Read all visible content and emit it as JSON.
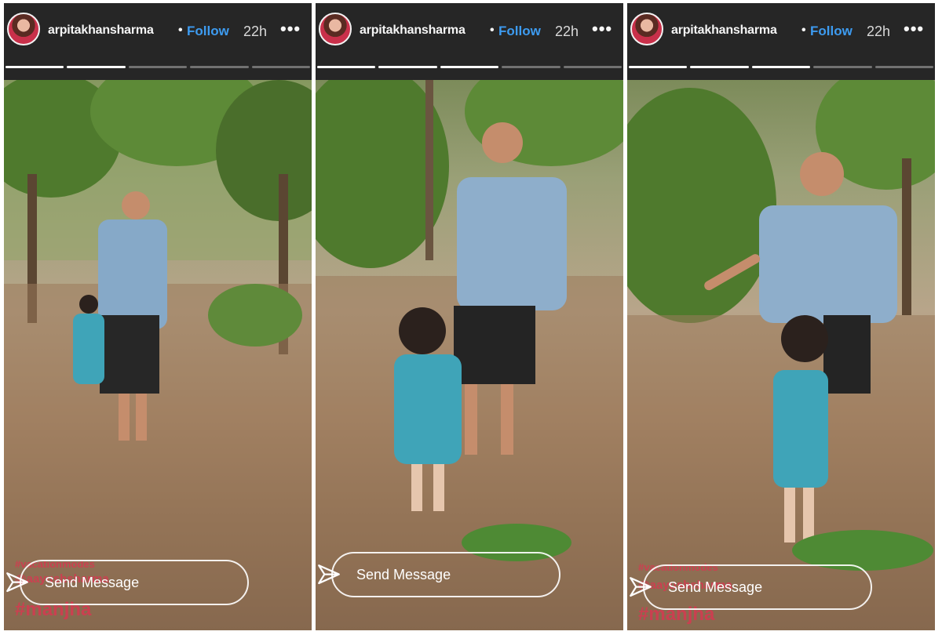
{
  "stories": [
    {
      "username": "arpitakhansharma",
      "separator": "•",
      "follow_label": "Follow",
      "timestamp": "22h",
      "more_icon": "more-horizontal-icon",
      "progress": [
        1,
        1,
        0,
        0,
        0
      ],
      "tags": [
        "#vacationmodes",
        "@aayushsharma",
        "#manjha"
      ],
      "message_placeholder": "Send Message",
      "send_icon": "paper-plane-icon"
    },
    {
      "username": "arpitakhansharma",
      "separator": "•",
      "follow_label": "Follow",
      "timestamp": "22h",
      "more_icon": "more-horizontal-icon",
      "progress": [
        1,
        1,
        1,
        0,
        0
      ],
      "tags": [],
      "message_placeholder": "Send Message",
      "send_icon": "paper-plane-icon"
    },
    {
      "username": "arpitakhansharma",
      "separator": "•",
      "follow_label": "Follow",
      "timestamp": "22h",
      "more_icon": "more-horizontal-icon",
      "progress": [
        1,
        1,
        1,
        0,
        0
      ],
      "tags": [
        "#vacationmodes",
        "@aayushsharma",
        "#manjha"
      ],
      "message_placeholder": "Send Message",
      "send_icon": "paper-plane-icon"
    }
  ],
  "colors": {
    "follow": "#3d9bf0",
    "panel_bg": "#262626",
    "hashtag": "#d63850"
  }
}
